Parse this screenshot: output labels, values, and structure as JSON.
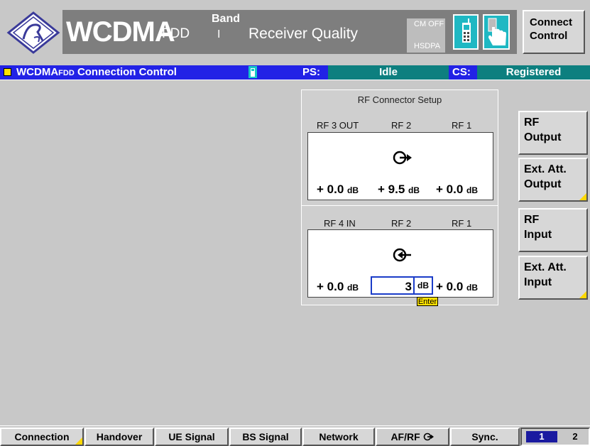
{
  "header": {
    "product": "WCDMA",
    "product_sub": "FDD",
    "band_label": "Band",
    "band_value": "I",
    "mode_title": "Receiver Quality",
    "cm_status_1": "CM OFF",
    "cm_status_2": "HSDPA",
    "connect_control_line1": "Connect",
    "connect_control_line2": "Control"
  },
  "status_bar": {
    "title_main": "WCDMA",
    "title_fdd": "FDD",
    "title_rest": "Connection Control",
    "ps_label": "PS:",
    "ps_value": "Idle",
    "cs_label": "CS:",
    "cs_value": "Registered"
  },
  "rf_setup": {
    "title": "RF Connector Setup",
    "output": {
      "connectors": [
        "RF 3 OUT",
        "RF 2",
        "RF 1"
      ],
      "values": [
        "+ 0.0",
        "+ 9.5",
        "+ 0.0"
      ],
      "unit": "dB"
    },
    "input": {
      "connectors": [
        "RF 4 IN",
        "RF 2",
        "RF 1"
      ],
      "values": [
        "+ 0.0",
        "3",
        "+ 0.0"
      ],
      "unit": "dB",
      "enter_hint": "Enter"
    }
  },
  "side_buttons": [
    {
      "line1": "RF",
      "line2": "Output"
    },
    {
      "line1": "Ext. Att.",
      "line2": "Output"
    },
    {
      "line1": "RF",
      "line2": "Input"
    },
    {
      "line1": "Ext. Att.",
      "line2": "Input"
    }
  ],
  "tabs": [
    "Connection",
    "Handover",
    "UE Signal",
    "BS Signal",
    "Network",
    "AF/RF",
    "Sync."
  ],
  "pages": [
    "1",
    "2"
  ],
  "colors": {
    "accent_blue": "#2222e6",
    "teal": "#0d7f7f",
    "enter_yellow": "#ffe100"
  }
}
